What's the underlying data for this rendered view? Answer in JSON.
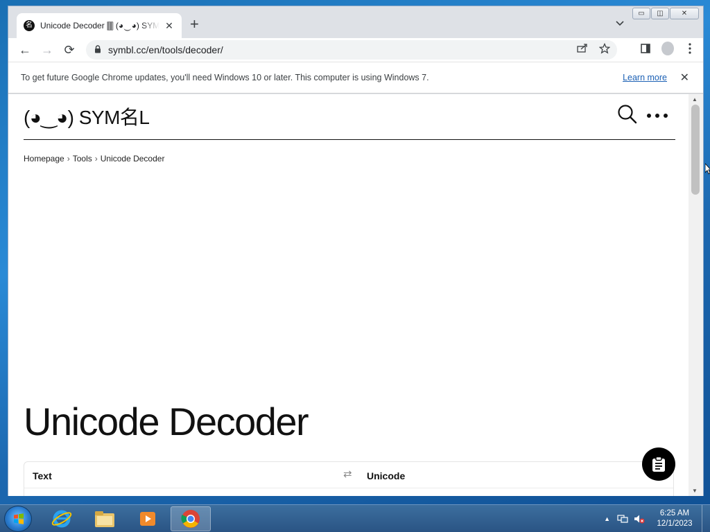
{
  "browser": {
    "tab": {
      "favicon": "名",
      "title": "Unicode Decoder 🀫 (◕‿◕) SYMBL",
      "close": "✕"
    },
    "new_tab": "+",
    "tab_search": "⌄",
    "window_controls": {
      "minimize": "▭",
      "maximize": "◫",
      "close": "✕"
    },
    "nav": {
      "back": "←",
      "forward": "→",
      "reload": "⟳"
    },
    "url": "symbl.cc/en/tools/decoder/",
    "lock_icon": "🔒",
    "infobar": {
      "message": "To get future Google Chrome updates, you'll need Windows 10 or later. This computer is using Windows 7.",
      "link": "Learn more",
      "close": "✕"
    }
  },
  "site": {
    "logo": "(◕‿◕) SYM名L",
    "menu_icon": "•••",
    "breadcrumb": [
      "Homepage",
      "Tools",
      "Unicode Decoder"
    ],
    "breadcrumb_sep": "›",
    "title": "Unicode Decoder",
    "decoder": {
      "col_text": "Text",
      "swap_icon": "⇄",
      "col_unicode": "Unicode"
    }
  },
  "taskbar": {
    "clock_time": "6:25 AM",
    "clock_date": "12/1/2023",
    "tray_arrow": "▲"
  }
}
